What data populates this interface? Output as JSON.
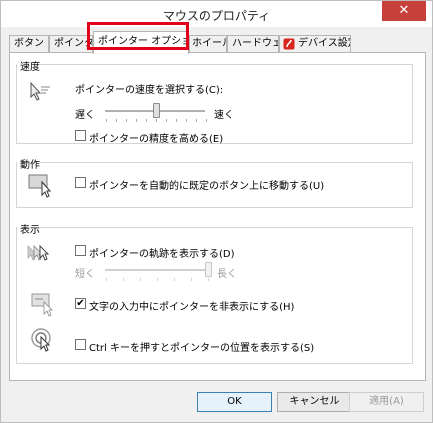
{
  "window": {
    "title": "マウスのプロパティ",
    "close_glyph": "✕"
  },
  "tabs": [
    {
      "label": "ボタン"
    },
    {
      "label": "ポインター"
    },
    {
      "label": "ポインター オプション",
      "active": true
    },
    {
      "label": "ホイール"
    },
    {
      "label": "ハードウェア"
    },
    {
      "label": "デバイス設定"
    }
  ],
  "speed": {
    "title": "速度",
    "label": "ポインターの速度を選択する(C):",
    "slow": "遅く",
    "fast": "速く",
    "slider_level": 0.5,
    "precision_label": "ポインターの精度を高める(E)",
    "precision_checked": false
  },
  "snap": {
    "title": "動作",
    "label": "ポインターを自動的に既定のボタン上に移動する(U)",
    "checked": false
  },
  "visibility": {
    "title": "表示",
    "trails_label": "ポインターの軌跡を表示する(D)",
    "trails_checked": false,
    "short": "短く",
    "long": "長く",
    "trails_level": 1.0,
    "hide_label": "文字の入力中にポインターを非表示にする(H)",
    "hide_checked": true,
    "ctrl_label": "Ctrl キーを押すとポインターの位置を表示する(S)",
    "ctrl_checked": false
  },
  "buttons": {
    "ok": "OK",
    "cancel": "キャンセル",
    "apply": "適用(A)"
  },
  "colors": {
    "highlight": "#e3001b",
    "close": "#c7403a"
  }
}
